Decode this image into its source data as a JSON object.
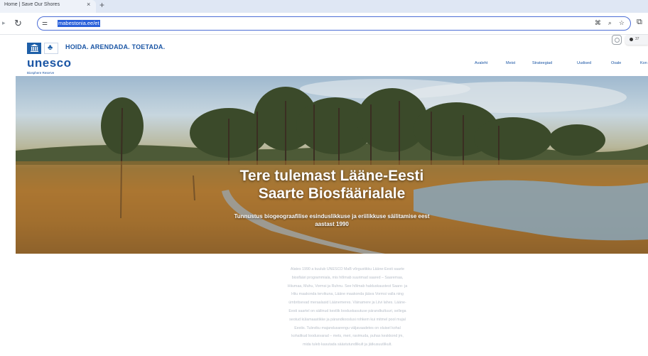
{
  "browser": {
    "tab_title": "Home | Save Our Shores",
    "url": "mabestonia.ee/et"
  },
  "icons": {
    "reload": "reload-icon",
    "site_info": "site-info-icon",
    "translate": "translate-icon",
    "zoom": "zoom-icon",
    "bookmark": "star-icon",
    "extensions": "extensions-icon",
    "instagram": "instagram-icon"
  },
  "site": {
    "brand": "unesco",
    "brand_sub": "Biosphere Reserve",
    "tagline": "HOIDA. ARENDADA. TOETADA.",
    "chip_text": "37",
    "nav": [
      "Avaleht",
      "Meist",
      "Strateegiad",
      "Uudised",
      "Osale",
      "Kon"
    ]
  },
  "hero": {
    "title_line1": "Tere tulemast Lääne-Eesti",
    "title_line2": "Saarte Biosfäärialale",
    "subtitle_line1": "Tunnustus biogeograafilise esinduslikkuse ja eriilikkuse säilitamise eest",
    "subtitle_line2": "aastast 1990"
  },
  "intro": {
    "lines": [
      "Alates 1990 a kuulub UNESCO MaB võrgustikku Lääne-Eesti saarte",
      "biosfääri programmiala, mis hõlmab suurimad saared – Saaremaa,",
      "Hiiumaa, Muhu, Vormsi ja Ruhnu. See hõlmab halduskaustest Saare- ja",
      "Hiiu maakonda tervikuna, Lääne maakonda jääva Vormsi valla ning",
      "ümbritsevad meraalasid Läänemeres. Väinamere ja Liivi lahes. Lääne-",
      "Eesti saartel on säilinud kestlik looduskasutuse pärandkultuuri, sellega",
      "seotud külamaastikke ja pärandkooslusi rohkem kui mitmel pool mujal",
      "Eestis. Tuleviku majandusarengu väljavaadetes on oluisel kohal",
      "kohalikud loodusvarad – mets, meri, ravimuda, puhas keskkond jm,",
      "mida tuleb kasutada säästutundlikult ja jätkusuutlikult."
    ]
  }
}
